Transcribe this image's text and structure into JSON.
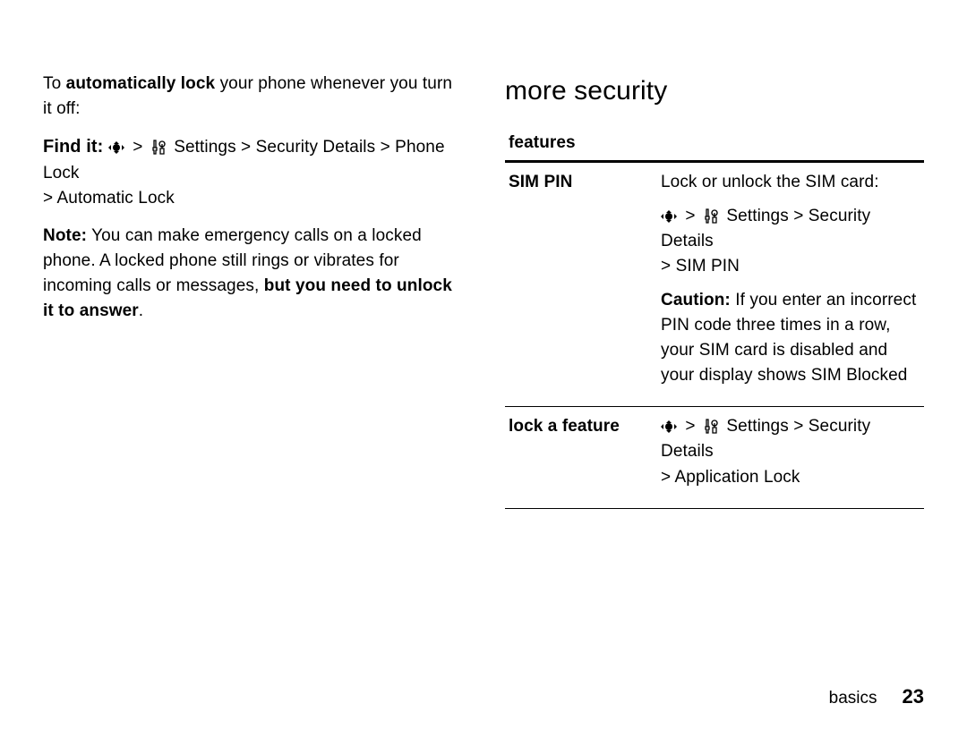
{
  "left": {
    "intro_pre": "To ",
    "intro_bold": "automatically lock",
    "intro_post": " your phone whenever you turn it off:",
    "find_label": "Find it:",
    "find_path_settings_security": " Settings > Security Details",
    "find_path_phone_lock": " > Phone Lock",
    "find_path_auto_lock": "> Automatic Lock",
    "note_label": "Note:",
    "note_body_pre": " You can make emergency calls on a locked phone. A locked phone still rings or vibrates for incoming calls or messages, ",
    "note_bold": "but you need to unlock it to answer",
    "note_period": "."
  },
  "right": {
    "heading": "more security",
    "table_header": "features",
    "rows": [
      {
        "name": "SIM PIN",
        "lock_unlock": "Lock or unlock the SIM card:",
        "path_settings_security": " Settings > Security Details",
        "path_sim": "> SIM PIN",
        "caution_label": "Caution:",
        "caution_body": " If you enter an incorrect PIN code three times in a row, your SIM card is disabled and your display shows ",
        "sim_blocked": "SIM Blocked"
      },
      {
        "name": "lock a feature",
        "path_settings_security": " Settings > Security Details",
        "path_app_lock": "> Application Lock"
      }
    ]
  },
  "footer": {
    "section": "basics",
    "page": "23"
  },
  "glyphs": {
    "gt": ">",
    "nav": "navigation-key-icon",
    "tools": "settings-toolkit-icon"
  }
}
